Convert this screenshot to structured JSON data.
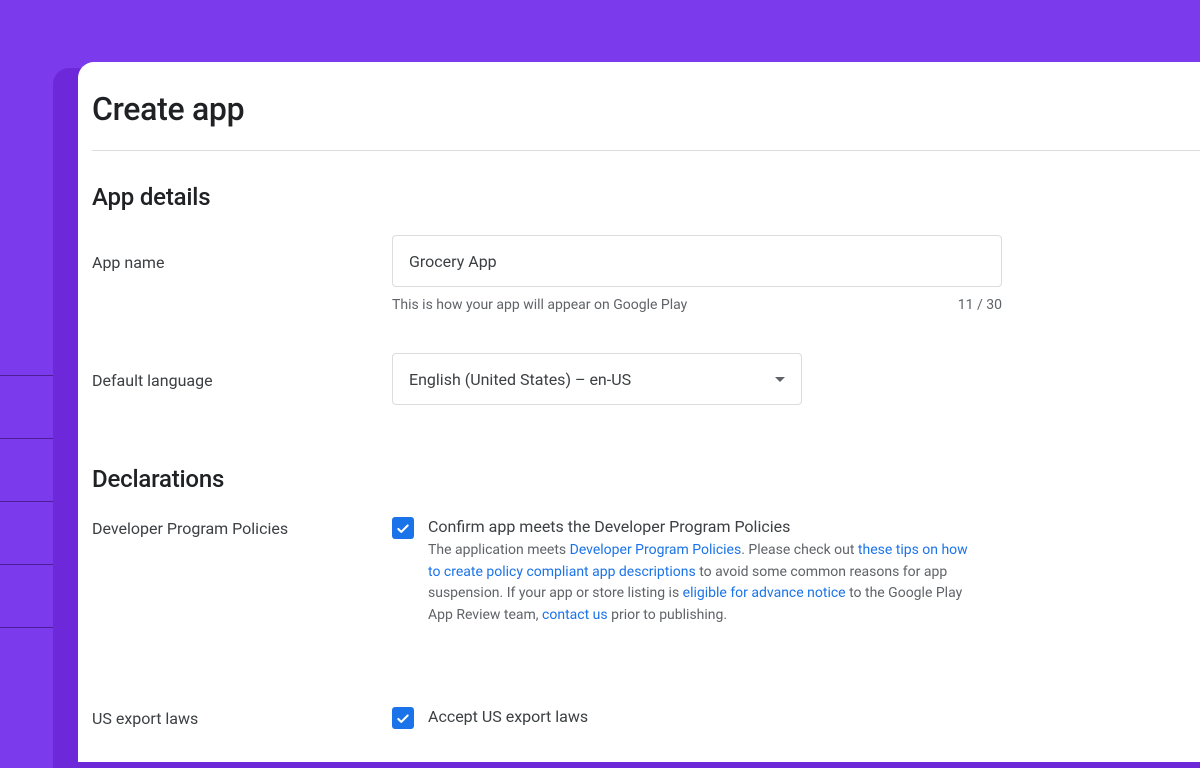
{
  "page": {
    "title": "Create app"
  },
  "sections": {
    "appDetails": {
      "title": "App details",
      "appName": {
        "label": "App name",
        "value": "Grocery App",
        "helper": "This is how your app will appear on Google Play",
        "counter": "11 / 30"
      },
      "defaultLanguage": {
        "label": "Default language",
        "value": "English (United States) – en-US"
      }
    },
    "declarations": {
      "title": "Declarations",
      "developerPolicies": {
        "label": "Developer Program Policies",
        "checkboxTitle": "Confirm app meets the Developer Program Policies",
        "description": {
          "part1": "The application meets ",
          "link1": "Developer Program Policies",
          "part2": ". Please check out ",
          "link2": "these tips on how to create policy compliant app descriptions",
          "part3": " to avoid some common reasons for app suspension. If your app or store listing is ",
          "link3": "eligible for advance notice",
          "part4": " to the Google Play App Review team, ",
          "link4": "contact us",
          "part5": " prior to publishing."
        }
      },
      "exportLaws": {
        "label": "US export laws",
        "checkboxTitle": "Accept US export laws"
      }
    }
  }
}
